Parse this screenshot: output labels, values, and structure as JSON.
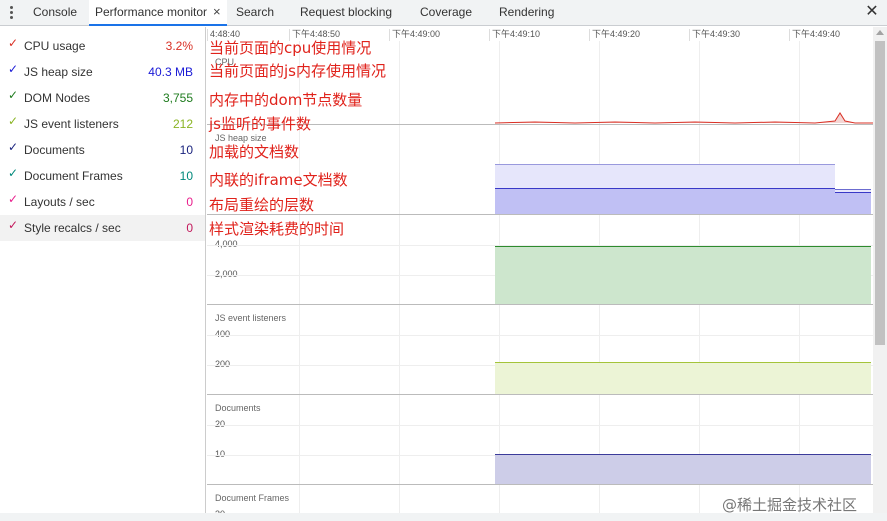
{
  "tabs": {
    "menu_icon": "kebab-menu-icon",
    "items": [
      {
        "label": "Console"
      },
      {
        "label": "Performance monitor"
      },
      {
        "label": "Search"
      },
      {
        "label": "Request blocking"
      },
      {
        "label": "Coverage"
      },
      {
        "label": "Rendering"
      }
    ],
    "close_glyph": "×",
    "panel_close_glyph": "✕",
    "active_color": "#1a73e8"
  },
  "metrics": [
    {
      "name": "CPU usage",
      "value": "3.2%",
      "color": "#d93025"
    },
    {
      "name": "JS heap size",
      "value": "40.3 MB",
      "color": "#1a1ad6"
    },
    {
      "name": "DOM Nodes",
      "value": "3,755",
      "color": "#1e7b1e"
    },
    {
      "name": "JS event listeners",
      "value": "212",
      "color": "#8ab424"
    },
    {
      "name": "Documents",
      "value": "10",
      "color": "#1a237e"
    },
    {
      "name": "Document Frames",
      "value": "10",
      "color": "#00897b"
    },
    {
      "name": "Layouts / sec",
      "value": "0",
      "color": "#e91e8c"
    },
    {
      "name": "Style recalcs / sec",
      "value": "0",
      "color": "#c2185b"
    }
  ],
  "check_glyph": "✓",
  "time_ticks": [
    "4:48:40",
    "下午4:48:50",
    "下午4:49:00",
    "下午4:49:10",
    "下午4:49:20",
    "下午4:49:30",
    "下午4:49:40"
  ],
  "panels": {
    "cpu": {
      "title": "CPU"
    },
    "heap": {
      "title": "JS heap size"
    },
    "dom": {
      "y_labels": [
        "4,000",
        "2,000"
      ]
    },
    "listeners": {
      "title": "JS event listeners",
      "y_labels": [
        "400",
        "200"
      ]
    },
    "documents": {
      "title": "Documents",
      "y_labels": [
        "20",
        "10"
      ]
    },
    "frames": {
      "title": "Document Frames",
      "y_labels": [
        "30"
      ]
    }
  },
  "annotations": [
    "当前页面的cpu使用情况",
    "当前页面的js内存使用情况",
    "内存中的dom节点数量",
    "js监听的事件数",
    "加载的文档数",
    "内联的iframe文档数",
    "布局重绘的层数",
    "样式渲染耗费的时间"
  ],
  "watermark": "@稀土掘金技术社区"
}
